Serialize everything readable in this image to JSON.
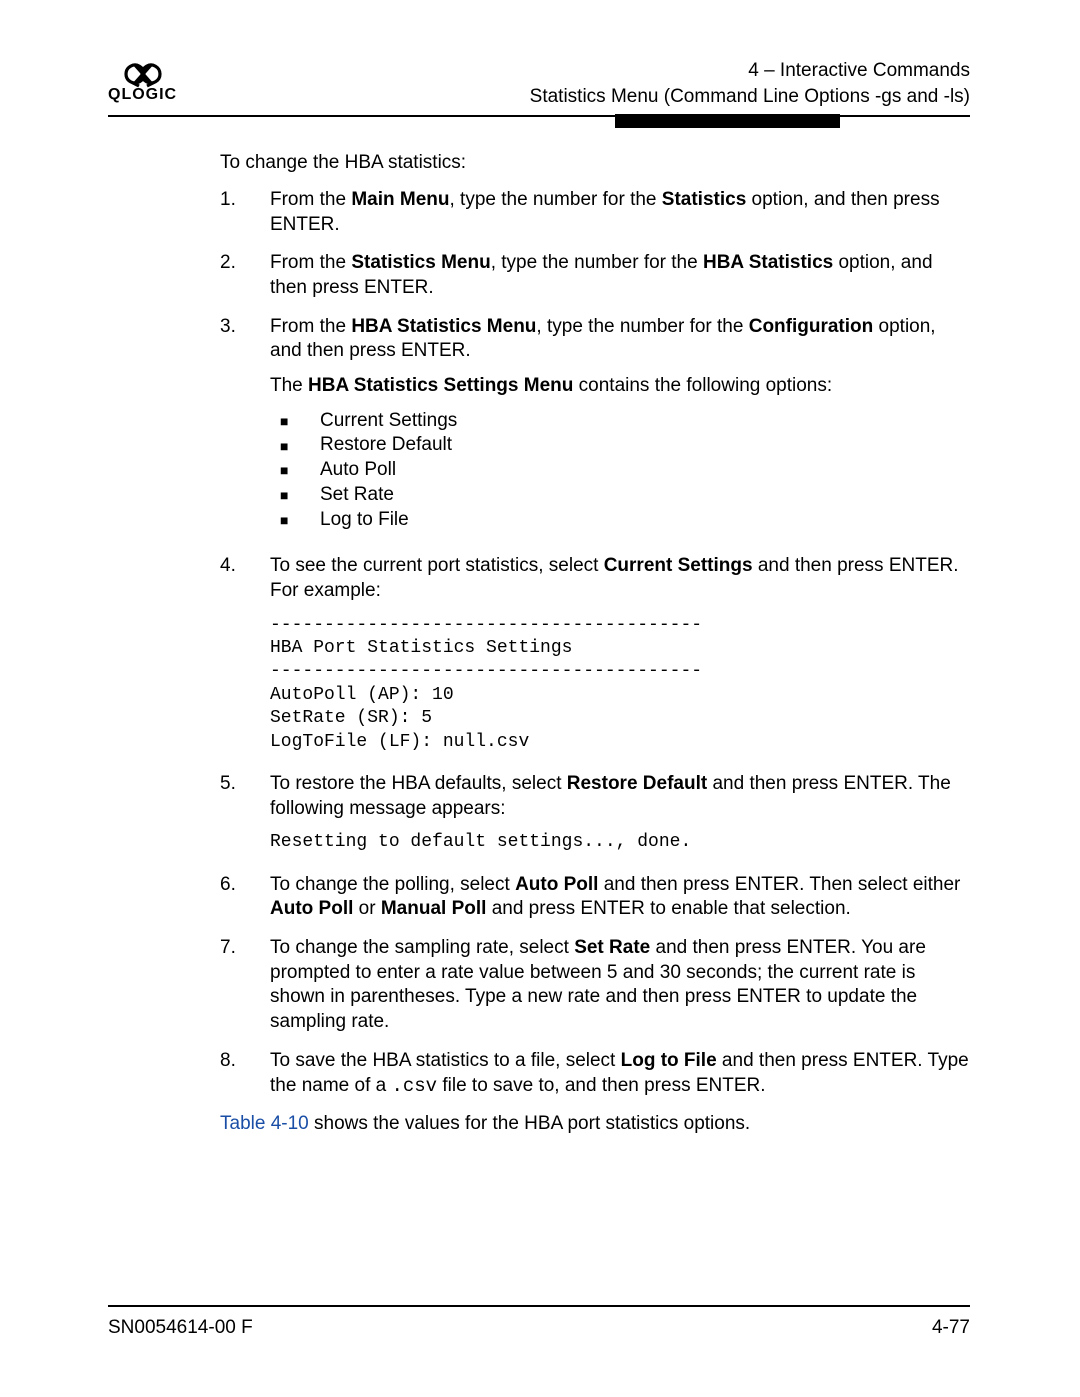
{
  "header": {
    "logo_text": "QLOGIC",
    "line1": "4 – Interactive Commands",
    "line2": "Statistics Menu (Command Line Options -gs and -ls)"
  },
  "content": {
    "lead": "To change the HBA statistics:",
    "steps": [
      {
        "num": "1.",
        "para1_pre": "From the ",
        "para1_b1": "Main Menu",
        "para1_mid": ", type the number for the ",
        "para1_b2": "Statistics",
        "para1_post": " option, and then press ENTER."
      },
      {
        "num": "2.",
        "para1_pre": "From the ",
        "para1_b1": "Statistics Menu",
        "para1_mid": ", type the number for the ",
        "para1_b2": "HBA Statistics",
        "para1_post": " option, and then press ENTER."
      },
      {
        "num": "3.",
        "para1_pre": "From the ",
        "para1_b1": "HBA Statistics Menu",
        "para1_mid": ", type the number for the ",
        "para1_b2": "Configuration",
        "para1_post": " option, and then press ENTER.",
        "para2_pre": "The ",
        "para2_b": "HBA Statistics Settings Menu",
        "para2_post": " contains the following options:",
        "bullets": [
          "Current Settings",
          "Restore Default",
          "Auto Poll",
          "Set Rate",
          "Log to File"
        ]
      },
      {
        "num": "4.",
        "para1_pre": "To see the current port statistics, select ",
        "para1_b1": "Current Settings",
        "para1_post": " and then press ENTER. For example:",
        "code": "----------------------------------------\nHBA Port Statistics Settings\n----------------------------------------\nAutoPoll (AP): 10\nSetRate (SR): 5\nLogToFile (LF): null.csv"
      },
      {
        "num": "5.",
        "para1_pre": "To restore the HBA defaults, select ",
        "para1_b1": "Restore Default",
        "para1_post": " and then press ENTER. The following message appears:",
        "code": "Resetting to default settings..., done."
      },
      {
        "num": "6.",
        "para1_pre": "To change the polling, select ",
        "para1_b1": "Auto Poll",
        "para1_mid": " and then press ENTER. Then select either ",
        "para1_b2": "Auto Poll",
        "para1_mid2": " or ",
        "para1_b3": "Manual Poll",
        "para1_post": " and press ENTER to enable that selection."
      },
      {
        "num": "7.",
        "para1_pre": "To change the sampling rate, select ",
        "para1_b1": "Set Rate",
        "para1_post": " and then press ENTER. You are prompted to enter a rate value between 5 and 30 seconds; the current rate is shown in parentheses. Type a new rate and then press ENTER to update the sampling rate."
      },
      {
        "num": "8.",
        "para1_pre": "To save the HBA statistics to a file, select ",
        "para1_b1": "Log to File",
        "para1_mid": " and then press ENTER. Type the name of a ",
        "para1_code": ".csv",
        "para1_post": " file to save to, and then press ENTER."
      }
    ],
    "closing_link": "Table 4-10",
    "closing_post": " shows the values for the HBA port statistics options."
  },
  "footer": {
    "left": "SN0054614-00 F",
    "right": "4-77"
  }
}
